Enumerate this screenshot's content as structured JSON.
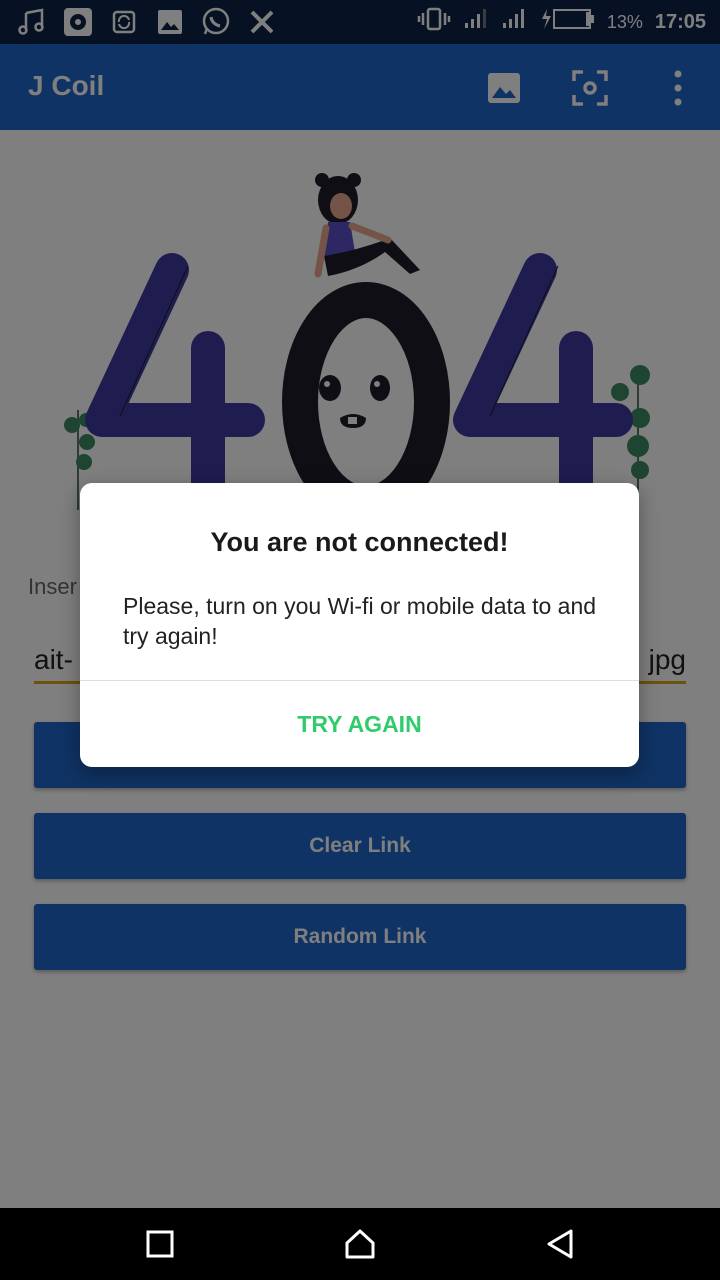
{
  "status_bar": {
    "left_icons": [
      "music-icon",
      "app-icon",
      "sync-icon",
      "image-icon",
      "whatsapp-icon",
      "x-icon"
    ],
    "right_icons": [
      "vibrate-icon",
      "signal-icon",
      "signal-icon",
      "battery-charging-icon"
    ],
    "battery_percent": "13%",
    "time": "17:05"
  },
  "app_bar": {
    "title": "J Coil",
    "actions": [
      "image-icon",
      "scan-icon",
      "more-vert-icon"
    ]
  },
  "content": {
    "illustration": "404-illustration",
    "input_label": "Inser",
    "link_visible_start": "ait-",
    "link_visible_end": "jpg",
    "buttons": {
      "primary": "",
      "clear": "Clear Link",
      "random": "Random Link"
    }
  },
  "dialog": {
    "title": "You are not connected!",
    "message": "Please, turn on you Wi-fi or mobile data to and try again!",
    "action": "TRY AGAIN"
  },
  "nav_bar": {
    "buttons": [
      "recents-icon",
      "home-icon",
      "back-icon"
    ]
  },
  "colors": {
    "status_bar": "#0c2447",
    "app_bar": "#1f67c9",
    "accent_underline": "#d9a416",
    "dialog_action": "#2ecc6a",
    "illustration_purple": "#3f3a9e",
    "illustration_dark": "#1f1d2b"
  }
}
